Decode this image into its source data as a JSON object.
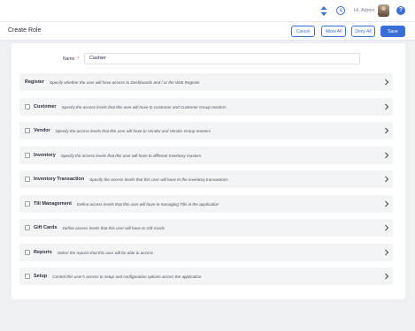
{
  "topbar": {
    "greeting": "Hi, Admin",
    "icons": [
      "sort-arrows-icon",
      "clock-icon",
      "avatar",
      "help-icon"
    ],
    "help_glyph": "?"
  },
  "header": {
    "title": "Create Role",
    "cancel_label": "Cancel",
    "allow_all_label": "Allow All",
    "deny_all_label": "Deny All",
    "save_label": "Save"
  },
  "form": {
    "name_label": "Name",
    "required_marker": "*",
    "name_value": "Cashier"
  },
  "sections": [
    {
      "title": "Register",
      "desc": "Specify whether the user will have access to Dashboards and / or the Web Register",
      "checkbox": false
    },
    {
      "title": "Customer",
      "desc": "Specify the access levels that this user will have to Customer and Customer Group masters",
      "checkbox": true
    },
    {
      "title": "Vendor",
      "desc": "Specify the access levels that this user will have to Vendor and Vendor Group masters",
      "checkbox": true
    },
    {
      "title": "Inventory",
      "desc": "Specify the access levels that this user will have to different Inventory masters",
      "checkbox": true
    },
    {
      "title": "Inventory Transaction",
      "desc": "Specify the access levels that this user will have to the inventory transactions",
      "checkbox": true
    },
    {
      "title": "Till Management",
      "desc": "Define access levels that this user will have to managing Tills in the application",
      "checkbox": true
    },
    {
      "title": "Gift Cards",
      "desc": "Define access levels that this user will have to Gift Cards",
      "checkbox": true
    },
    {
      "title": "Reports",
      "desc": "Select the reports that this user will be able to access",
      "checkbox": true
    },
    {
      "title": "Setup",
      "desc": "Control this user's access to setup and configuration options across the application",
      "checkbox": true
    }
  ],
  "colors": {
    "accent": "#3b6fd8",
    "page_bg": "#eef0f4",
    "row_bg": "#f3f4f6",
    "required": "#e04848"
  }
}
